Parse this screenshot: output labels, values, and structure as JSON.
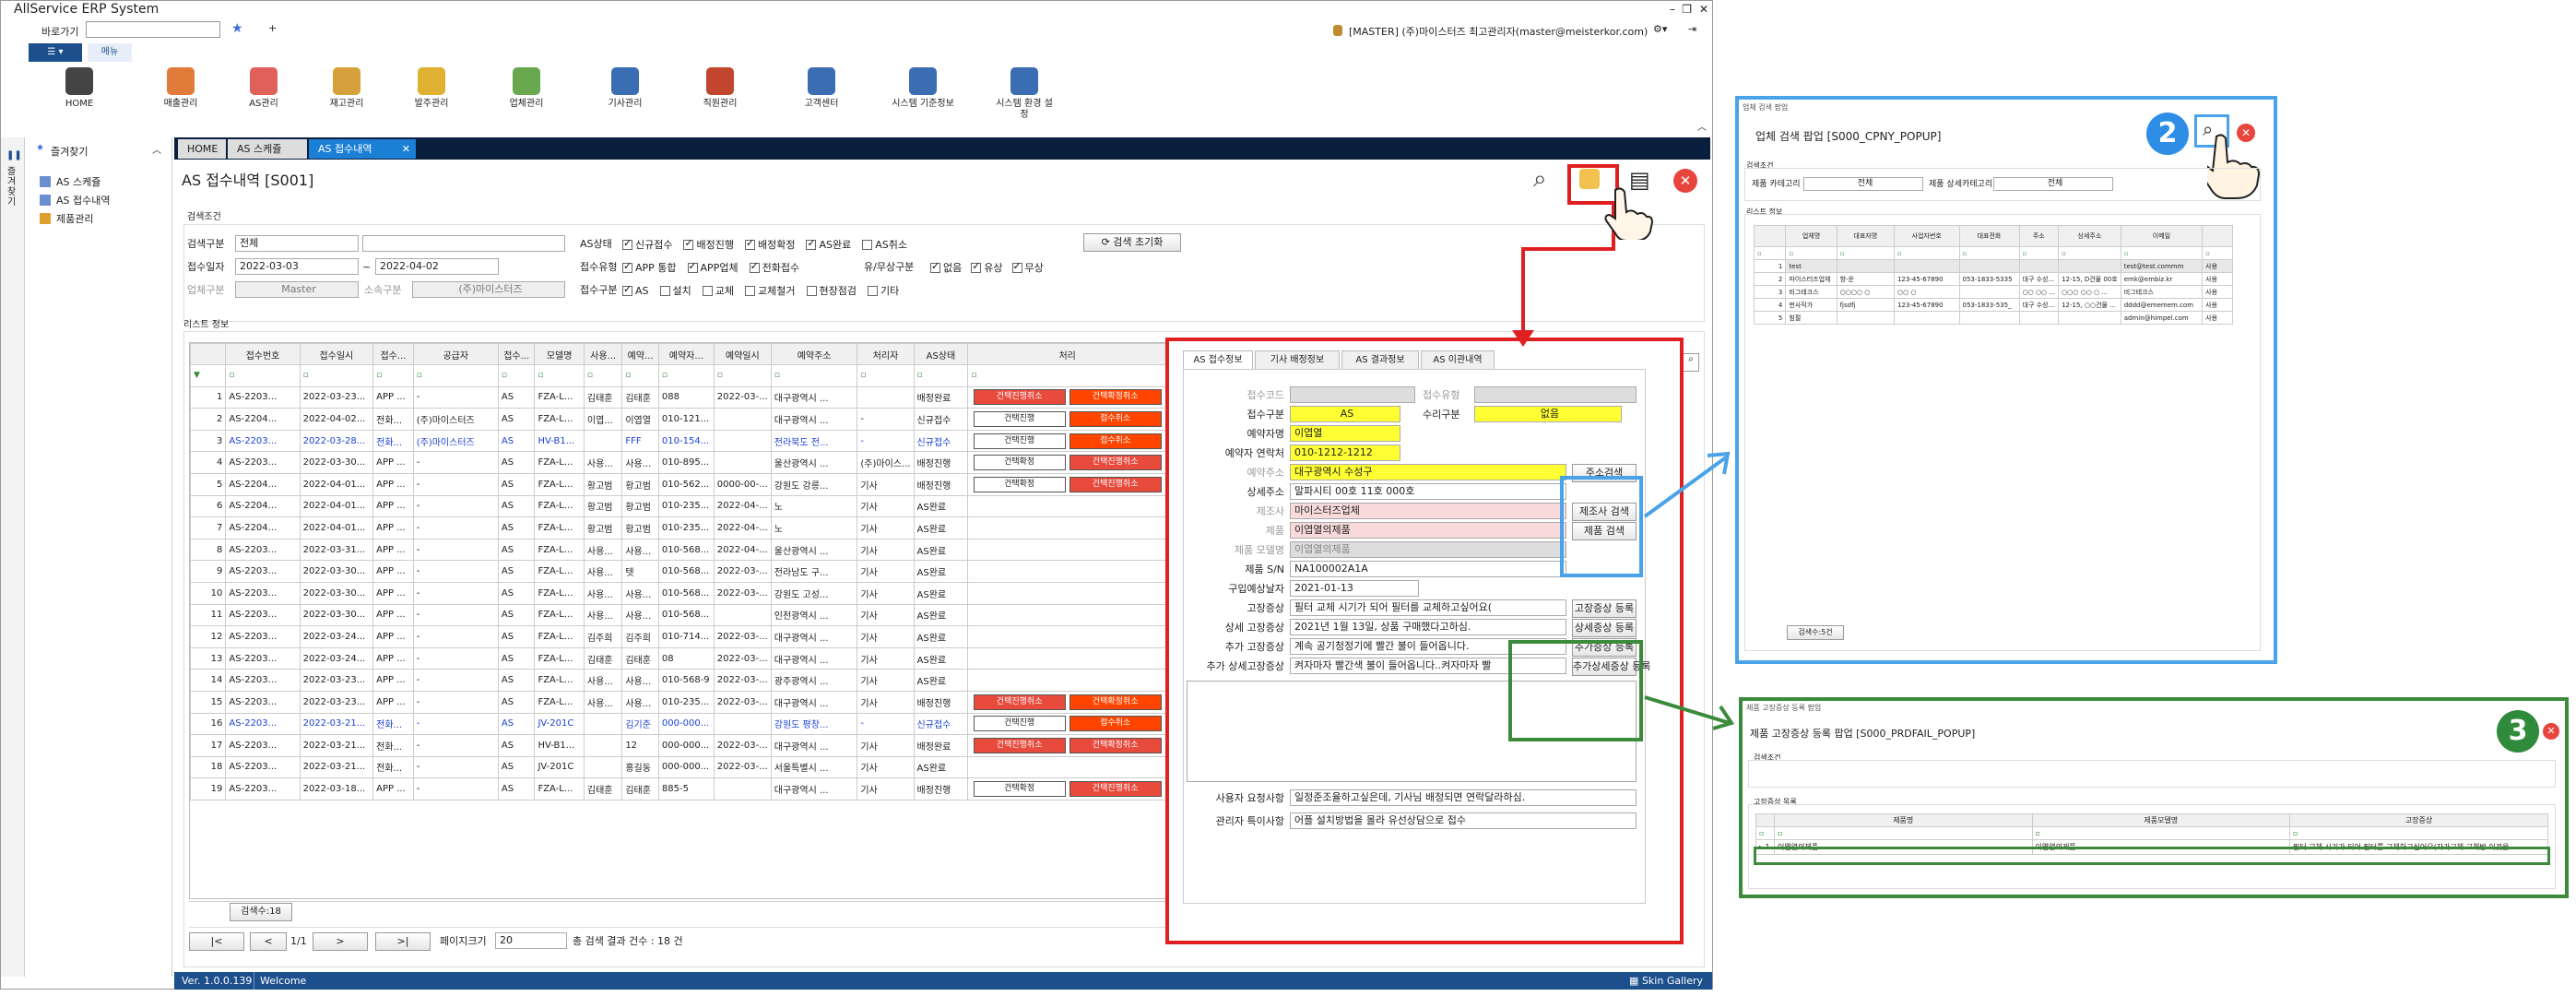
{
  "app": {
    "title": "AllService ERP System",
    "version": "Ver. 1.0.0.139",
    "welcome": "Welcome",
    "skin": "Skin Gallery"
  },
  "topbar": {
    "shortcut_label": "바로가기",
    "user": "[MASTER] (주)마이스터즈 최고관리자(master@meisterkor.com)",
    "menu_tab": "메뉴"
  },
  "ribbon": [
    {
      "label": "HOME",
      "color": "#444444"
    },
    {
      "label": "매출관리",
      "color": "#e07b39"
    },
    {
      "label": "AS관리",
      "color": "#e0605a"
    },
    {
      "label": "재고관리",
      "color": "#d6a13a"
    },
    {
      "label": "발주관리",
      "color": "#e0b030"
    },
    {
      "label": "업체관리",
      "color": "#6aa84f"
    },
    {
      "label": "기사관리",
      "color": "#3b6db3"
    },
    {
      "label": "직원관리",
      "color": "#c2452d"
    },
    {
      "label": "고객센터",
      "color": "#3b6db3"
    },
    {
      "label": "시스템 기준정보",
      "color": "#3b6db3"
    },
    {
      "label": "시스템 환경 설정",
      "color": "#3b6db3"
    }
  ],
  "leftnav": {
    "strip": "즐겨찾기",
    "header": "즐겨찾기",
    "items": [
      "AS 스케쥴",
      "AS 접수내역",
      "제품관리"
    ]
  },
  "doctabs": [
    "HOME",
    "AS 스케쥴",
    "AS 접수내역"
  ],
  "page": {
    "title": "AS 접수내역 [S001]"
  },
  "search": {
    "section": "검색조건",
    "search_type_label": "검색구분",
    "search_type_value": "전체",
    "date_label": "접수일자",
    "date_from": "2022-03-03",
    "date_to": "2022-04-02",
    "tilde": "~",
    "vendor_type_label": "업체구분",
    "vendor_type_value": "Master",
    "affil_label": "소속구분",
    "affil_value": "(주)마이스터즈",
    "status_label": "AS상태",
    "status_opts": [
      {
        "t": "신규접수",
        "on": true
      },
      {
        "t": "배정진행",
        "on": true
      },
      {
        "t": "배정확정",
        "on": true
      },
      {
        "t": "AS완료",
        "on": true
      },
      {
        "t": "AS취소",
        "on": false
      }
    ],
    "recv_type_label": "접수유형",
    "recv_opts": [
      {
        "t": "APP 통합",
        "on": true
      },
      {
        "t": "APP업체",
        "on": true
      },
      {
        "t": "전화접수",
        "on": true
      }
    ],
    "pay_label": "유/무상구분",
    "pay_opts": [
      {
        "t": "없음",
        "on": true
      },
      {
        "t": "유상",
        "on": true
      },
      {
        "t": "무상",
        "on": true
      }
    ],
    "recv_class_label": "접수구분",
    "class_opts": [
      {
        "t": "AS",
        "on": true
      },
      {
        "t": "설치",
        "on": false
      },
      {
        "t": "교체",
        "on": false
      },
      {
        "t": "교체철거",
        "on": false
      },
      {
        "t": "현장점검",
        "on": false
      },
      {
        "t": "기타",
        "on": false
      }
    ],
    "reset_button": "검색 초기화"
  },
  "list": {
    "section": "리스트 정보",
    "columns": [
      "",
      "접수번호",
      "접수일시",
      "접수...",
      "공급자",
      "접수...",
      "모델명",
      "사용...",
      "예약...",
      "예약자...",
      "예약일시",
      "예약주소",
      "처리자",
      "AS상태",
      "처리"
    ],
    "rows": [
      {
        "n": "1",
        "id": "AS-2203...",
        "dt": "2022-03-23...",
        "rt": "APP ...",
        "sp": "-",
        "c": "AS",
        "m": "FZA-L...",
        "u": "김태훈",
        "r": "김태훈",
        "p": "088",
        "rd": "2022-03-...",
        "a": "대구광역시 ...",
        "w": "",
        "s": "배정완료",
        "b1": "건택진행취소",
        "b2": "건택확정취소",
        "k1": "red",
        "k2": "orange",
        "blue": false
      },
      {
        "n": "2",
        "id": "AS-2204...",
        "dt": "2022-04-02...",
        "rt": "전화...",
        "sp": "(주)마이스터즈",
        "c": "AS",
        "m": "FZA-L...",
        "u": "이엽...",
        "r": "이엽열",
        "p": "010-121...",
        "rd": "",
        "a": "대구광역시 ...",
        "w": "-",
        "s": "신규접수",
        "b1": "건택진행",
        "b2": "접수취소",
        "k1": "white",
        "k2": "orange",
        "blue": false
      },
      {
        "n": "3",
        "id": "AS-2203...",
        "dt": "2022-03-28...",
        "rt": "전화...",
        "sp": "(주)마이스터즈",
        "c": "AS",
        "m": "HV-B1...",
        "u": "",
        "r": "FFF",
        "p": "010-154...",
        "rd": "",
        "a": "전라북도 전...",
        "w": "-",
        "s": "신규접수",
        "b1": "건택진행",
        "b2": "접수취소",
        "k1": "white",
        "k2": "orange",
        "blue": true
      },
      {
        "n": "4",
        "id": "AS-2203...",
        "dt": "2022-03-30...",
        "rt": "APP ...",
        "sp": "-",
        "c": "AS",
        "m": "FZA-L...",
        "u": "사용...",
        "r": "사용...",
        "p": "010-895...",
        "rd": "",
        "a": "울산광역시 ...",
        "w": "(주)마이스...",
        "s": "배정진행",
        "b1": "건택확정",
        "b2": "건택진행취소",
        "k1": "white",
        "k2": "red",
        "blue": false
      },
      {
        "n": "5",
        "id": "AS-2204...",
        "dt": "2022-04-01...",
        "rt": "APP ...",
        "sp": "-",
        "c": "AS",
        "m": "FZA-L...",
        "u": "황고범",
        "r": "황고범",
        "p": "010-562...",
        "rd": "0000-00-...",
        "a": "강원도 강릉...",
        "w": "기사",
        "s": "배정진행",
        "b1": "건택확정",
        "b2": "건택진행취소",
        "k1": "white",
        "k2": "red",
        "blue": false
      },
      {
        "n": "6",
        "id": "AS-2204...",
        "dt": "2022-04-01...",
        "rt": "APP ...",
        "sp": "-",
        "c": "AS",
        "m": "FZA-L...",
        "u": "황고범",
        "r": "황고범",
        "p": "010-235...",
        "rd": "2022-04-...",
        "a": "노",
        "w": "기사",
        "s": "AS완료",
        "b1": "",
        "b2": "",
        "blue": false
      },
      {
        "n": "7",
        "id": "AS-2204...",
        "dt": "2022-04-01...",
        "rt": "APP ...",
        "sp": "-",
        "c": "AS",
        "m": "FZA-L...",
        "u": "황고범",
        "r": "황고범",
        "p": "010-235...",
        "rd": "2022-04-...",
        "a": "노",
        "w": "기사",
        "s": "AS완료",
        "b1": "",
        "b2": "",
        "blue": false
      },
      {
        "n": "8",
        "id": "AS-2203...",
        "dt": "2022-03-31...",
        "rt": "APP ...",
        "sp": "-",
        "c": "AS",
        "m": "FZA-L...",
        "u": "사용...",
        "r": "사용...",
        "p": "010-568...",
        "rd": "2022-04-...",
        "a": "울산광역시 ...",
        "w": "기사",
        "s": "AS완료",
        "b1": "",
        "b2": "",
        "blue": false
      },
      {
        "n": "9",
        "id": "AS-2203...",
        "dt": "2022-03-30...",
        "rt": "APP ...",
        "sp": "-",
        "c": "AS",
        "m": "FZA-L...",
        "u": "사용...",
        "r": "텟",
        "p": "010-568...",
        "rd": "2022-03-...",
        "a": "전라남도 구...",
        "w": "기사",
        "s": "AS완료",
        "b1": "",
        "b2": "",
        "blue": false
      },
      {
        "n": "10",
        "id": "AS-2203...",
        "dt": "2022-03-30...",
        "rt": "APP ...",
        "sp": "-",
        "c": "AS",
        "m": "FZA-L...",
        "u": "사용...",
        "r": "사용...",
        "p": "010-568...",
        "rd": "2022-03-...",
        "a": "강원도 고성...",
        "w": "기사",
        "s": "AS완료",
        "b1": "",
        "b2": "",
        "blue": false
      },
      {
        "n": "11",
        "id": "AS-2203...",
        "dt": "2022-03-30...",
        "rt": "APP ...",
        "sp": "-",
        "c": "AS",
        "m": "FZA-L...",
        "u": "사용...",
        "r": "사용...",
        "p": "010-568...",
        "rd": "",
        "a": "인천광역시 ...",
        "w": "기사",
        "s": "AS완료",
        "b1": "",
        "b2": "",
        "blue": false
      },
      {
        "n": "12",
        "id": "AS-2203...",
        "dt": "2022-03-24...",
        "rt": "APP ...",
        "sp": "-",
        "c": "AS",
        "m": "FZA-L...",
        "u": "김주희",
        "r": "김주희",
        "p": "010-714...",
        "rd": "2022-03-...",
        "a": "대구광역시 ...",
        "w": "기사",
        "s": "AS완료",
        "b1": "",
        "b2": "",
        "blue": false
      },
      {
        "n": "13",
        "id": "AS-2203...",
        "dt": "2022-03-24...",
        "rt": "APP ...",
        "sp": "-",
        "c": "AS",
        "m": "FZA-L...",
        "u": "김태훈",
        "r": "김태훈",
        "p": "08",
        "rd": "2022-03-...",
        "a": "대구광역시 ...",
        "w": "기사",
        "s": "AS완료",
        "b1": "",
        "b2": "",
        "blue": false
      },
      {
        "n": "14",
        "id": "AS-2203...",
        "dt": "2022-03-23...",
        "rt": "APP ...",
        "sp": "-",
        "c": "AS",
        "m": "FZA-L...",
        "u": "사용...",
        "r": "사용...",
        "p": "010-568-9",
        "rd": "2022-03-...",
        "a": "광주광역시 ...",
        "w": "기사",
        "s": "AS완료",
        "b1": "",
        "b2": "",
        "blue": false
      },
      {
        "n": "15",
        "id": "AS-2203...",
        "dt": "2022-03-23...",
        "rt": "APP ...",
        "sp": "-",
        "c": "AS",
        "m": "FZA-L...",
        "u": "사용...",
        "r": "사용...",
        "p": "010-235...",
        "rd": "2022-03-...",
        "a": "대구광역시 ...",
        "w": "기사",
        "s": "배정진행",
        "b1": "건택진행취소",
        "b2": "건택확정취소",
        "k1": "red",
        "k2": "orange",
        "blue": false
      },
      {
        "n": "16",
        "id": "AS-2203...",
        "dt": "2022-03-21...",
        "rt": "전화...",
        "sp": "-",
        "c": "AS",
        "m": "JV-201C",
        "u": "",
        "r": "김기준",
        "p": "000-000...",
        "rd": "",
        "a": "강원도 평창...",
        "w": "-",
        "s": "신규접수",
        "b1": "건택진행",
        "b2": "접수취소",
        "k1": "white",
        "k2": "orange",
        "blue": true
      },
      {
        "n": "17",
        "id": "AS-2203...",
        "dt": "2022-03-21...",
        "rt": "전화...",
        "sp": "-",
        "c": "AS",
        "m": "HV-B1...",
        "u": "",
        "r": "12",
        "p": "000-000...",
        "rd": "2022-03-...",
        "a": "대구광역시 ...",
        "w": "기사",
        "s": "배정완료",
        "b1": "건택진행취소",
        "b2": "건택확정취소",
        "k1": "red",
        "k2": "red",
        "blue": false
      },
      {
        "n": "18",
        "id": "AS-2203...",
        "dt": "2022-03-21...",
        "rt": "전화...",
        "sp": "-",
        "c": "AS",
        "m": "JV-201C",
        "u": "",
        "r": "홍길동",
        "p": "000-000...",
        "rd": "2022-03-...",
        "a": "서울특별시 ...",
        "w": "기사",
        "s": "AS완료",
        "b1": "",
        "b2": "",
        "blue": false
      },
      {
        "n": "19",
        "id": "AS-2203...",
        "dt": "2022-03-18...",
        "rt": "APP ...",
        "sp": "-",
        "c": "AS",
        "m": "FZA-L...",
        "u": "김태훈",
        "r": "김태훈",
        "p": "885-5",
        "rd": "",
        "a": "대구광역시 ...",
        "w": "기사",
        "s": "배정진행",
        "b1": "건택확정",
        "b2": "건택진행취소",
        "k1": "white",
        "k2": "red",
        "blue": false
      }
    ],
    "count": "검색수:18",
    "pager": {
      "first": "|<",
      "prev": "<",
      "page": "1/1",
      "next": ">",
      "last": ">|",
      "size_label": "페이지크기",
      "size": "20",
      "total": "총 검색 결과 건수 : 18 건"
    }
  },
  "detail": {
    "tabs": [
      "AS 접수정보",
      "기사 배정정보",
      "AS 결과정보",
      "AS 이관내역"
    ],
    "f_code_label": "접수코드",
    "f_state_label": "접수유형",
    "f_class_label": "접수구분",
    "f_class_value": "AS",
    "f_repair_label": "수리구분",
    "f_repair_value": "없음",
    "f_name_label": "예약자명",
    "f_name_value": "이엽열",
    "f_phone_label": "예약자 연락처",
    "f_phone_value": "010-1212-1212",
    "f_addr_label": "예약주소",
    "f_addr_value": "대구광역시 수성구",
    "addr_btn": "주소검색",
    "f_addr2_label": "상세주소",
    "f_addr2_value": "말파시티 00호 11호 000호",
    "f_maker_label": "제조사",
    "f_maker_value": "마이스터즈업체",
    "maker_btn": "제조사 검색",
    "f_prod_label": "제품",
    "f_prod_value": "이엽열의제품",
    "prod_btn": "제품 검색",
    "f_model_label": "제품 모델명",
    "f_model_value": "이엽열의제품",
    "f_sn_label": "제품 S/N",
    "f_sn_value": "NA100002A1A",
    "f_buy_label": "구입예상날자",
    "f_buy_value": "2021-01-13",
    "f_sym_label": "고장증상",
    "f_sym_value": "필터 교체 시기가 되어 필터를 교체하고싶어요(",
    "sym_btn": "고장증상 등록",
    "f_sym2_label": "상세 고장증상",
    "f_sym2_value": "2021년 1월 13일, 상품 구매했다고하심.",
    "sym2_btn": "상세증상 등록",
    "f_sym3_label": "추가 고장증상",
    "f_sym3_value": "계속 공기청정기에 빨간 불이 들어옵니다.",
    "sym3_btn": "추가증상 등록",
    "f_sym4_label": "추가 상세고장증상",
    "f_sym4_value": "켜자마자 빨간색 불이 들어옵니다..켜자마자 빨",
    "sym4_btn": "추가상세증상 등록",
    "f_req_label": "사용자 요청사항",
    "f_req_value": "일정준조율하고싶은데, 기사님 배정되면 연락달라하심.",
    "f_note_label": "관리자 특이사항",
    "f_note_value": "어플 설치방법을 몰라 유선상담으로 접수"
  },
  "popup1": {
    "window_title": "업체 검색 팝업",
    "title": "업체 검색 팝업 [S000_CPNY_POPUP]",
    "cond": "검색조건",
    "cat_label": "제품 카테고리",
    "cat_value": "전체",
    "detail_cat_label": "제품 상세카테고리",
    "detail_cat_value": "전체",
    "list": "리스트 정보",
    "columns": [
      "업체명",
      "대표자명",
      "사업자번호",
      "대표전화",
      "주소",
      "상세주소",
      "이메일",
      ""
    ],
    "rows": [
      [
        "test",
        "",
        "",
        "",
        "",
        "",
        "test@test.commm",
        "사용"
      ],
      [
        "마이스터즈업체",
        "항-운",
        "123-45-67890",
        "053-1833-5335",
        "대구 수성...",
        "12-15, D건물 00호",
        "emk@embiz.kr",
        "사용"
      ],
      [
        "비그테크스",
        "○○○○ ○",
        "○○ ○",
        "",
        "○○ ○○ ...",
        "○○○ ○○ ○ ...",
        "비그테크스",
        "사용"
      ],
      [
        "펀사작가",
        "fjsdfj",
        "123-45-67890",
        "053-1833-535_",
        "대구 수성...",
        "12-15, ○○건물 ...",
        "dddd@ememem.com",
        "사용"
      ],
      [
        "힘펄",
        "",
        "",
        "",
        "",
        "",
        "admin@himpel.com",
        "사용"
      ]
    ],
    "count": "검색수:5건",
    "badge": "2"
  },
  "popup2": {
    "window_title": "제품 고장증상 등록 팝업",
    "title": "제품 고장증상 등록 팝업 [S000_PRDFAIL_POPUP]",
    "cond": "검색조건",
    "list": "고장증상 목록",
    "columns": [
      "제품명",
      "제품모델명",
      "고장증상"
    ],
    "row": [
      "이엽열의제품",
      "이엽열의제품",
      "필터 교체 시기가 되어 필터를 교체하고싶어요(자가교체 교체방 이것을 ..."
    ],
    "badge": "3"
  },
  "colors": {
    "accent_red": "#e02020",
    "accent_blue": "#4aa3e8",
    "accent_green": "#3c8a3c",
    "badge_blue": "#2e8ee6",
    "badge_green": "#2f8a3c",
    "status_bar": "#1c4f8c",
    "yellow_field": "#ffff33",
    "pink_field": "#f9dada"
  }
}
